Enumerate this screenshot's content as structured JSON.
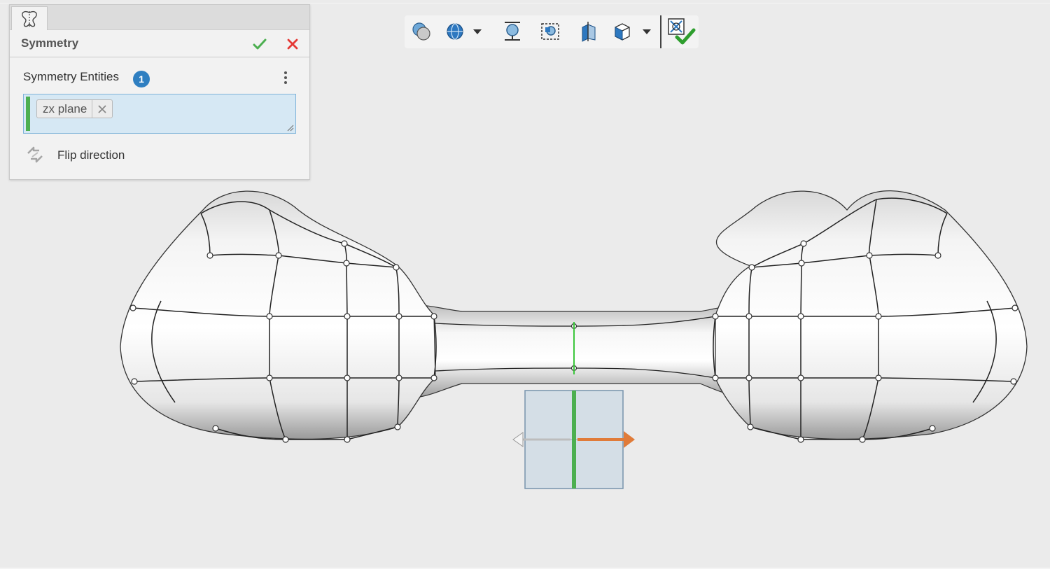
{
  "panel": {
    "title": "Symmetry",
    "tab_icon": "symmetry-icon",
    "ok_icon": "check-icon",
    "cancel_icon": "close-icon",
    "section": {
      "label": "Symmetry Entities",
      "count": "1",
      "menu_icon": "more-vertical-icon"
    },
    "selection": {
      "items": [
        {
          "label": "zx plane",
          "remove_icon": "close-icon"
        }
      ]
    },
    "flip": {
      "label": "Flip direction",
      "icon": "flip-direction-icon"
    }
  },
  "toolbar": {
    "items": [
      {
        "icon": "display-style-icon"
      },
      {
        "icon": "view-sphere-icon",
        "dropdown": true
      },
      {
        "icon": "zoom-to-fit-icon"
      },
      {
        "icon": "zoom-to-area-icon"
      },
      {
        "icon": "section-view-icon"
      },
      {
        "icon": "view-orientation-icon",
        "dropdown": true
      },
      {
        "icon": "accept-manipulator-icon"
      }
    ]
  },
  "colors": {
    "accent_blue": "#2f7fc1",
    "selection_bg": "#d6e8f4",
    "selection_bar": "#4caf50",
    "ok_green": "#4caf50",
    "cancel_red": "#e53935",
    "manipulator_arrow": "#e07b39",
    "symmetry_line": "#3cc63c"
  }
}
